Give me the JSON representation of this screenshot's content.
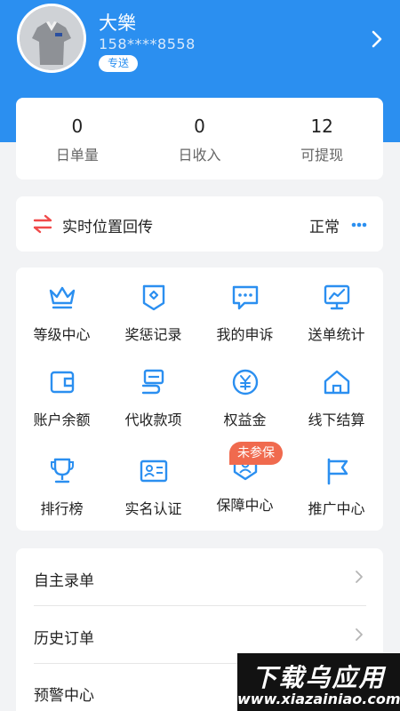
{
  "profile": {
    "name": "大樂",
    "phone": "158****8558",
    "tag": "专送"
  },
  "stats": [
    {
      "value": "0",
      "label": "日单量"
    },
    {
      "value": "0",
      "label": "日收入"
    },
    {
      "value": "12",
      "label": "可提现"
    }
  ],
  "location": {
    "label": "实时位置回传",
    "status": "正常"
  },
  "grid": [
    {
      "label": "等级中心",
      "icon": "crown-icon"
    },
    {
      "label": "奖惩记录",
      "icon": "shield-record-icon"
    },
    {
      "label": "我的申诉",
      "icon": "message-dots-icon"
    },
    {
      "label": "送单统计",
      "icon": "chart-board-icon"
    },
    {
      "label": "账户余额",
      "icon": "wallet-icon"
    },
    {
      "label": "代收款项",
      "icon": "collection-icon"
    },
    {
      "label": "权益金",
      "icon": "yen-coin-icon"
    },
    {
      "label": "线下结算",
      "icon": "home-icon"
    },
    {
      "label": "排行榜",
      "icon": "trophy-icon"
    },
    {
      "label": "实名认证",
      "icon": "id-card-icon"
    },
    {
      "label": "保障中心",
      "icon": "person-shield-icon"
    },
    {
      "label": "推广中心",
      "icon": "flag-icon"
    }
  ],
  "grid_badge": "未参保",
  "menu": [
    {
      "label": "自主录单"
    },
    {
      "label": "历史订单"
    },
    {
      "label": "预警中心"
    }
  ],
  "watermark": {
    "top": "下载乌应用",
    "bottom": "www.xiazainiao.com"
  },
  "colors": {
    "primary": "#2b8ff0",
    "badge": "#f06a4e",
    "location_icon": "#f04a4a"
  }
}
